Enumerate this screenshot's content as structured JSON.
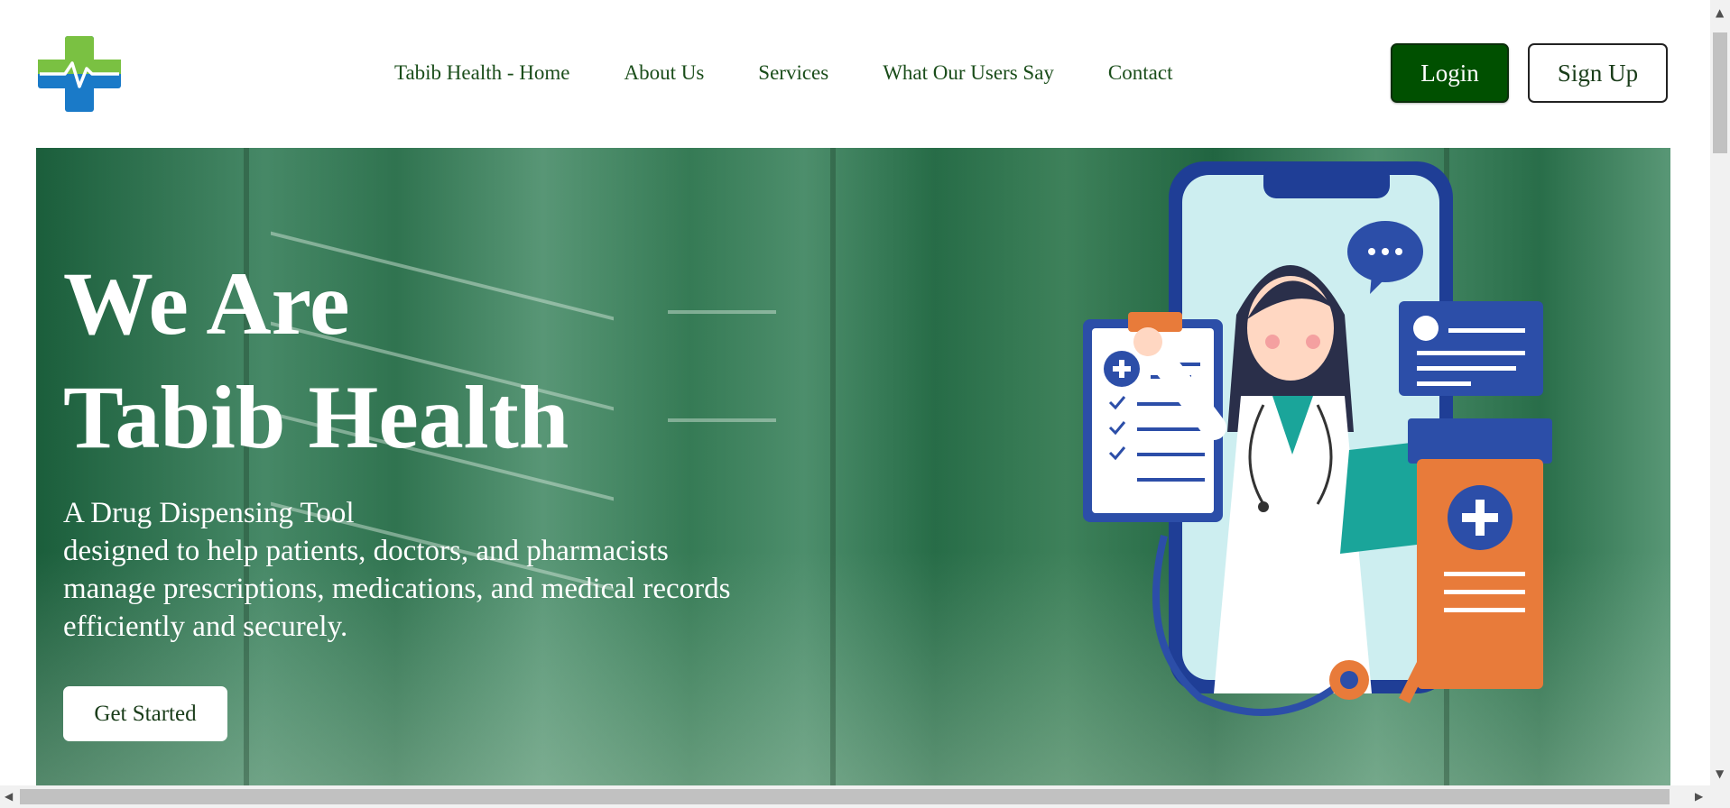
{
  "brand": {
    "logo": "medical-cross-pulse-logo",
    "colors": {
      "green": "#7ac142",
      "blue": "#1a7ac8"
    }
  },
  "nav": {
    "items": [
      {
        "label": "Tabib Health - Home"
      },
      {
        "label": "About Us"
      },
      {
        "label": "Services"
      },
      {
        "label": "What Our Users Say"
      },
      {
        "label": "Contact"
      }
    ]
  },
  "auth": {
    "login_label": "Login",
    "signup_label": "Sign Up",
    "login_color": "#005000"
  },
  "hero": {
    "title": "We Are\nTabib Health",
    "description": "A Drug Dispensing Tool\ndesigned to help patients, doctors, and pharmacists\nmanage prescriptions, medications, and medical records\nefficiently and securely.",
    "cta_label": "Get Started",
    "overlay_color": "#0a6e3c",
    "illustration": "doctor-on-phone-illustration"
  },
  "scrollbars": {
    "vertical": "scrollbar",
    "horizontal": "scrollbar"
  }
}
